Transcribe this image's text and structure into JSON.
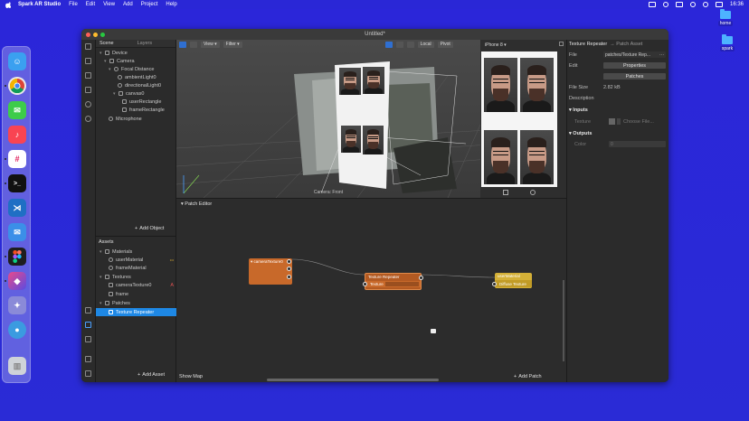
{
  "menubar": {
    "app_name": "Spark AR Studio",
    "items": [
      "File",
      "Edit",
      "View",
      "Add",
      "Project",
      "Help"
    ],
    "time": "16:36"
  },
  "desktop": {
    "folders": [
      {
        "label": "home"
      },
      {
        "label": "spark"
      }
    ]
  },
  "window": {
    "title": "Untitled*"
  },
  "scene": {
    "tabs": [
      "Scene",
      "Layers"
    ],
    "tree": [
      {
        "label": "Device",
        "icon": "device-icon"
      },
      {
        "label": "Camera",
        "icon": "camera-icon"
      },
      {
        "label": "Focal Distance",
        "icon": "focal-icon"
      },
      {
        "label": "ambientLight0",
        "icon": "light-icon"
      },
      {
        "label": "directionalLight0",
        "icon": "light-icon"
      },
      {
        "label": "canvas0",
        "icon": "canvas-icon"
      },
      {
        "label": "userRectangle",
        "icon": "rectangle-icon"
      },
      {
        "label": "frameRectangle",
        "icon": "rectangle-icon"
      },
      {
        "label": "Microphone",
        "icon": "microphone-icon"
      }
    ],
    "add_object": "Add Object"
  },
  "assets": {
    "title": "Assets",
    "tree": [
      {
        "label": "Materials",
        "icon": "folder-icon"
      },
      {
        "label": "userMaterial",
        "icon": "material-icon",
        "badge": "•••"
      },
      {
        "label": "frameMaterial",
        "icon": "material-icon"
      },
      {
        "label": "Textures",
        "icon": "folder-icon"
      },
      {
        "label": "cameraTexture0",
        "icon": "texture-icon",
        "badge": "A"
      },
      {
        "label": "frame",
        "icon": "image-icon"
      },
      {
        "label": "Patches",
        "icon": "folder-icon"
      },
      {
        "label": "Texture Repeater",
        "icon": "patch-icon"
      }
    ],
    "add_asset": "Add Asset"
  },
  "viewport": {
    "view_label": "View",
    "filter_label": "Filter",
    "local_label": "Local",
    "pivot_label": "Pivot",
    "caption": "Camera: Front"
  },
  "simulator": {
    "device": "iPhone 8"
  },
  "patch_editor": {
    "title": "Patch Editor",
    "show_map": "Show Map",
    "add_patch": "Add Patch",
    "nodes": {
      "camera_texture": {
        "title": "cameraTexture0"
      },
      "texture_repeater": {
        "title": "Texture Repeater",
        "port": "Texture"
      },
      "user_material": {
        "title": "userMaterial",
        "port": "Diffuse Texture"
      }
    }
  },
  "inspector": {
    "title": "Texture Repeater",
    "subtitle": "→ Patch Asset",
    "file_label": "File",
    "file_value": "patches/Texture Rep...",
    "edit_label": "Edit",
    "properties_btn": "Properties",
    "patches_btn": "Patches",
    "filesize_label": "File Size",
    "filesize_value": "2.82 kB",
    "description_label": "Description",
    "inputs_label": "Inputs",
    "texture_label": "Texture",
    "choose_file": "Choose File...",
    "outputs_label": "Outputs",
    "color_label": "Color",
    "color_value": "0"
  },
  "colors": {
    "accent": "#1e88e5",
    "node_orange": "#c8692a",
    "node_yellow": "#d4b037"
  }
}
